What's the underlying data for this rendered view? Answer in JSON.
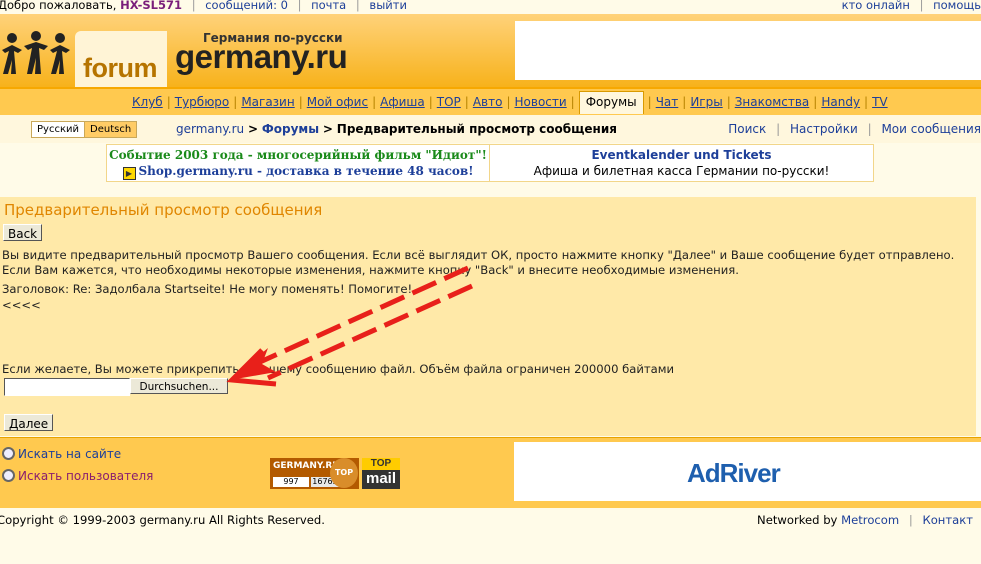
{
  "topbar": {
    "welcome": "Добро пожаловать,",
    "username": "HX-SL571",
    "messages": "сообщений: 0",
    "mail": "почта",
    "logout": "выйти",
    "online": "кто онлайн",
    "help": "помощь"
  },
  "header": {
    "forum_word": "forum",
    "tagline": "Германия по-русски",
    "site_name": "germany.ru"
  },
  "nav": {
    "items": [
      "Клуб",
      "Турбюро",
      "Магазин",
      "Мой офис",
      "Афиша",
      "ТОР",
      "Авто",
      "Новости",
      "Форумы",
      "Чат",
      "Игры",
      "Знакомства",
      "Handy",
      "TV"
    ],
    "active": "Форумы"
  },
  "lang": {
    "ru": "Русский",
    "de": "Deutsch"
  },
  "breadcrumb": {
    "site": "germany.ru",
    "sep": ">",
    "forums": "Форумы",
    "current": "Предварительный просмотр сообщения"
  },
  "crumb_links": {
    "search": "Поиск",
    "settings": "Настройки",
    "my_messages": "Мои сообщения"
  },
  "promo": {
    "left_line1": "Событие 2003 года - многосерийный фильм \"Идиот\"!",
    "left_line2": "Shop.germany.ru - доставка в течение 48 часов!",
    "right_line1": "Eventkalender und Tickets",
    "right_line2": "Афиша и билетная касса Германии по-русски!"
  },
  "panel": {
    "title": "Предварительный просмотр сообщения",
    "back_label": "Back",
    "intro": "Вы видите предварительный просмотр Вашего сообщения. Если всё выглядит ОК, просто нажмите кнопку \"Далее\" и Ваше сообщение будет отправлено. Если Вам кажется, что необходимы некоторые изменения, нажмите кнопку \"Back\" и внесите необходимые изменения.",
    "subject": "Заголовок: Re: Задолбала Startseite! Не могу поменять! Помогите!",
    "body": "<<<<",
    "attach_note": "Если желаете, Вы можете прикрепить к Вашему сообщению файл. Объём файла ограничен 200000 байтами",
    "file_value": "",
    "browse_label": "Durchsuchen...",
    "next_label": "Далее"
  },
  "footer": {
    "search_site": "Искать на сайте",
    "search_user": "Искать пользователя",
    "counter_title": "GERMANY.RU",
    "counter_n1": "997",
    "counter_n2": "16765",
    "counter_seal": "TOP",
    "topmail_1": "TOP",
    "topmail_2": "mail",
    "ad_logo": "AdRiver"
  },
  "bottom": {
    "copyright": "Copyright © 1999-2003 germany.ru All Rights Reserved.",
    "networked_by": "Networked by",
    "metrocom": "Metrocom",
    "contact": "Контакт"
  },
  "colors": {
    "accent": "#ffc94f",
    "title": "#e08600",
    "link": "#1d3f99",
    "arrow": "#e8201a"
  }
}
